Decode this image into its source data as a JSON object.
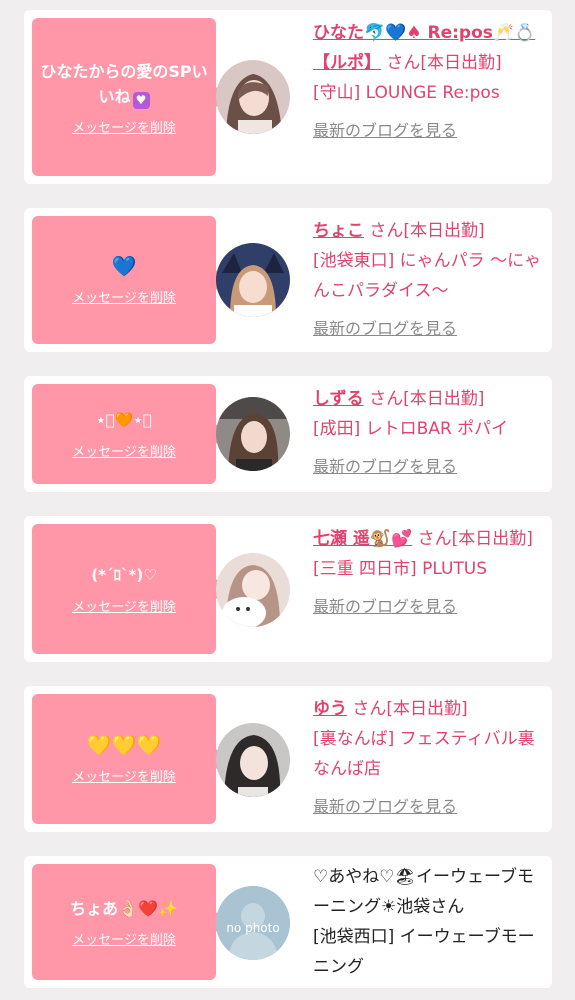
{
  "entries": [
    {
      "message": "ひなたからの愛のSPいいね",
      "message_emoji": "♥",
      "delete_label": "メッセージを削除",
      "name": "ひなた🐬💙♠ Re:pos🥂💍【ルポ】",
      "name_suffix": "さん",
      "status": "[本日出勤]",
      "shop": "[守山] LOUNGE Re:pos",
      "blog_link": "最新のブログを見る",
      "avatar_color": "#d9c7c4"
    },
    {
      "message": "💙",
      "delete_label": "メッセージを削除",
      "name": "ちょこ",
      "name_suffix": "さん",
      "status": "[本日出勤]",
      "shop": "[池袋東口] にゃんパラ 〜にゃんこパラダイス〜",
      "blog_link": "最新のブログを見る",
      "avatar_color": "#2f3f6a"
    },
    {
      "message": "⋆͛🧡⋆͛",
      "delete_label": "メッセージを削除",
      "name": "しずる",
      "name_suffix": "さん",
      "status": "[本日出勤]",
      "shop": "[成田] レトロBAR ポパイ",
      "blog_link": "最新のブログを見る",
      "avatar_color": "#8f8a86"
    },
    {
      "message": "(*´ﾛ`*)♡",
      "delete_label": "メッセージを削除",
      "name": "七瀬 遥🐒💕",
      "name_suffix": "さん",
      "status": "[本日出勤]",
      "shop": "[三重 四日市] PLUTUS",
      "blog_link": "最新のブログを見る",
      "avatar_color": "#eadcd7"
    },
    {
      "message": "💛💛💛",
      "delete_label": "メッセージを削除",
      "name": "ゆう",
      "name_suffix": "さん",
      "status": "[本日出勤]",
      "shop": "[裏なんば] フェスティバル裏なんば店",
      "blog_link": "最新のブログを見る",
      "avatar_color": "#c9c6c6"
    },
    {
      "message": "ちょあ👌🏻❤️✨",
      "delete_label": "メッセージを削除",
      "name": "♡あやね♡🏖イーウェーブモーニング☀池袋さん",
      "shop": "[池袋西口] イーウェーブモーニング",
      "avatar_text": "no photo",
      "avatar_color": "#a9c3d2"
    }
  ]
}
